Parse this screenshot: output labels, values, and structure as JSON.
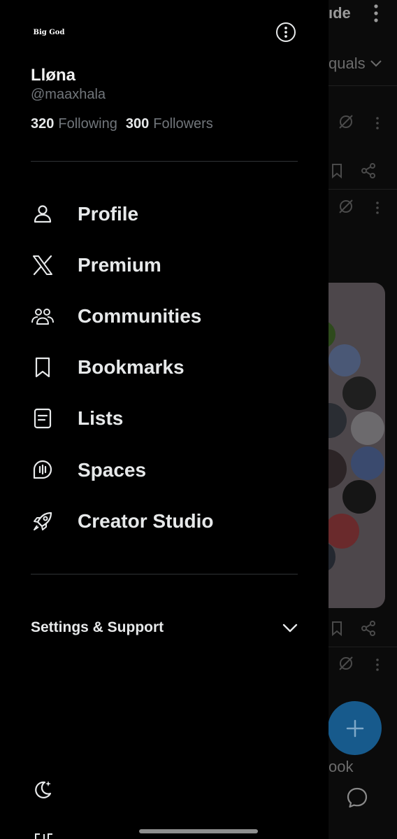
{
  "background": {
    "top_text": "ıde",
    "filter_text": "quals",
    "bottom_text": "ook",
    "icons": [
      "more-vertical-icon",
      "chevron-down-icon",
      "muted-icon",
      "bookmark-icon",
      "share-icon",
      "plus-icon",
      "chat-icon"
    ]
  },
  "profile": {
    "logo_text": "Big God",
    "display_name": "Lløna",
    "handle": "@maaxhala",
    "following_count": "320",
    "following_label": "Following",
    "followers_count": "300",
    "followers_label": "Followers"
  },
  "nav": {
    "items": [
      {
        "label": "Profile",
        "icon": "person-icon"
      },
      {
        "label": "Premium",
        "icon": "x-logo-icon"
      },
      {
        "label": "Communities",
        "icon": "communities-icon"
      },
      {
        "label": "Bookmarks",
        "icon": "bookmark-icon"
      },
      {
        "label": "Lists",
        "icon": "list-icon"
      },
      {
        "label": "Spaces",
        "icon": "spaces-icon"
      },
      {
        "label": "Creator Studio",
        "icon": "rocket-icon"
      }
    ]
  },
  "settings": {
    "label": "Settings & Support"
  },
  "colors": {
    "background": "#000000",
    "text": "#e7e9ea",
    "secondary_text": "#71767b",
    "divider": "#2f3336",
    "fab": "#175a8c"
  }
}
